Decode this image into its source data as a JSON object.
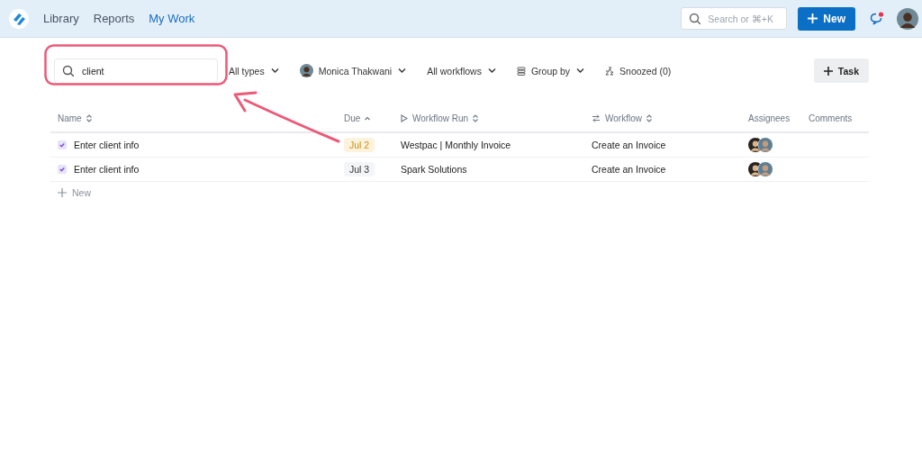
{
  "nav": {
    "items": [
      {
        "label": "Library",
        "selected": false
      },
      {
        "label": "Reports",
        "selected": false
      },
      {
        "label": "My Work",
        "selected": true
      }
    ]
  },
  "header": {
    "search_placeholder": "Search or ⌘+K",
    "new_button": "New",
    "unread_messages": true
  },
  "toolbar": {
    "search_value": "client",
    "filters": [
      {
        "kind": "dropdown",
        "label": "All types"
      },
      {
        "kind": "person",
        "label": "Monica Thakwani"
      },
      {
        "kind": "dropdown",
        "label": "All workflows"
      },
      {
        "kind": "group",
        "label": "Group by"
      },
      {
        "kind": "snooze",
        "label": "Snoozed (0)"
      }
    ],
    "task_button": "Task"
  },
  "table": {
    "columns": [
      {
        "label": "Name",
        "sortable": true,
        "sorted": false
      },
      {
        "label": "Due",
        "sortable": true,
        "sorted": true
      },
      {
        "label": "Workflow Run",
        "sortable": true,
        "sorted": false
      },
      {
        "label": "Workflow",
        "sortable": true,
        "sorted": false
      },
      {
        "label": "Assignees"
      },
      {
        "label": "Comments"
      }
    ],
    "rows": [
      {
        "name": "Enter client info",
        "checked": true,
        "due": "Jul 2",
        "due_soon": true,
        "workflow_run": "Westpac | Monthly Invoice",
        "workflow": "Create an Invoice"
      },
      {
        "name": "Enter client info",
        "checked": true,
        "due": "Jul 3",
        "due_soon": false,
        "workflow_run": "Spark Solutions",
        "workflow": "Create an Invoice"
      }
    ],
    "new_row": "New"
  }
}
